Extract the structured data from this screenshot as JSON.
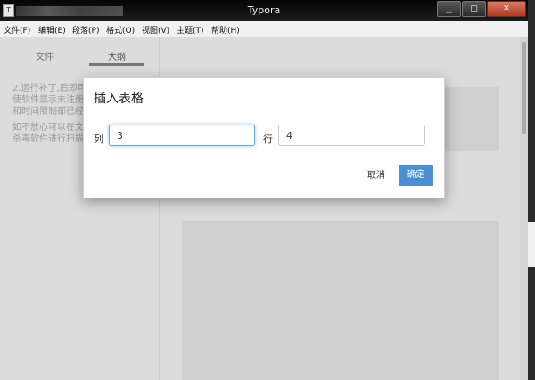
{
  "window": {
    "title": "Typora",
    "minimize": "▁",
    "maximize": "▢",
    "close": "✕"
  },
  "menu": [
    "文件(F)",
    "编辑(E)",
    "段落(P)",
    "格式(O)",
    "视图(V)",
    "主题(T)",
    "帮助(H)"
  ],
  "sidebar": {
    "tabs": [
      "文件",
      "大纲"
    ],
    "text_lines": [
      "2.运行补丁,后即可",
      "使软件显示未注册",
      "和时间限制都已经",
      "如不放心可以在文",
      "杀毒软件进行扫描"
    ]
  },
  "dialog": {
    "title": "插入表格",
    "cols_label": "列",
    "cols_value": "3",
    "rows_label": "行",
    "rows_value": "4",
    "cancel_label": "取消",
    "ok_label": "确定"
  },
  "colors": {
    "accent": "#4a8fcf",
    "titlebar": "#101010"
  }
}
